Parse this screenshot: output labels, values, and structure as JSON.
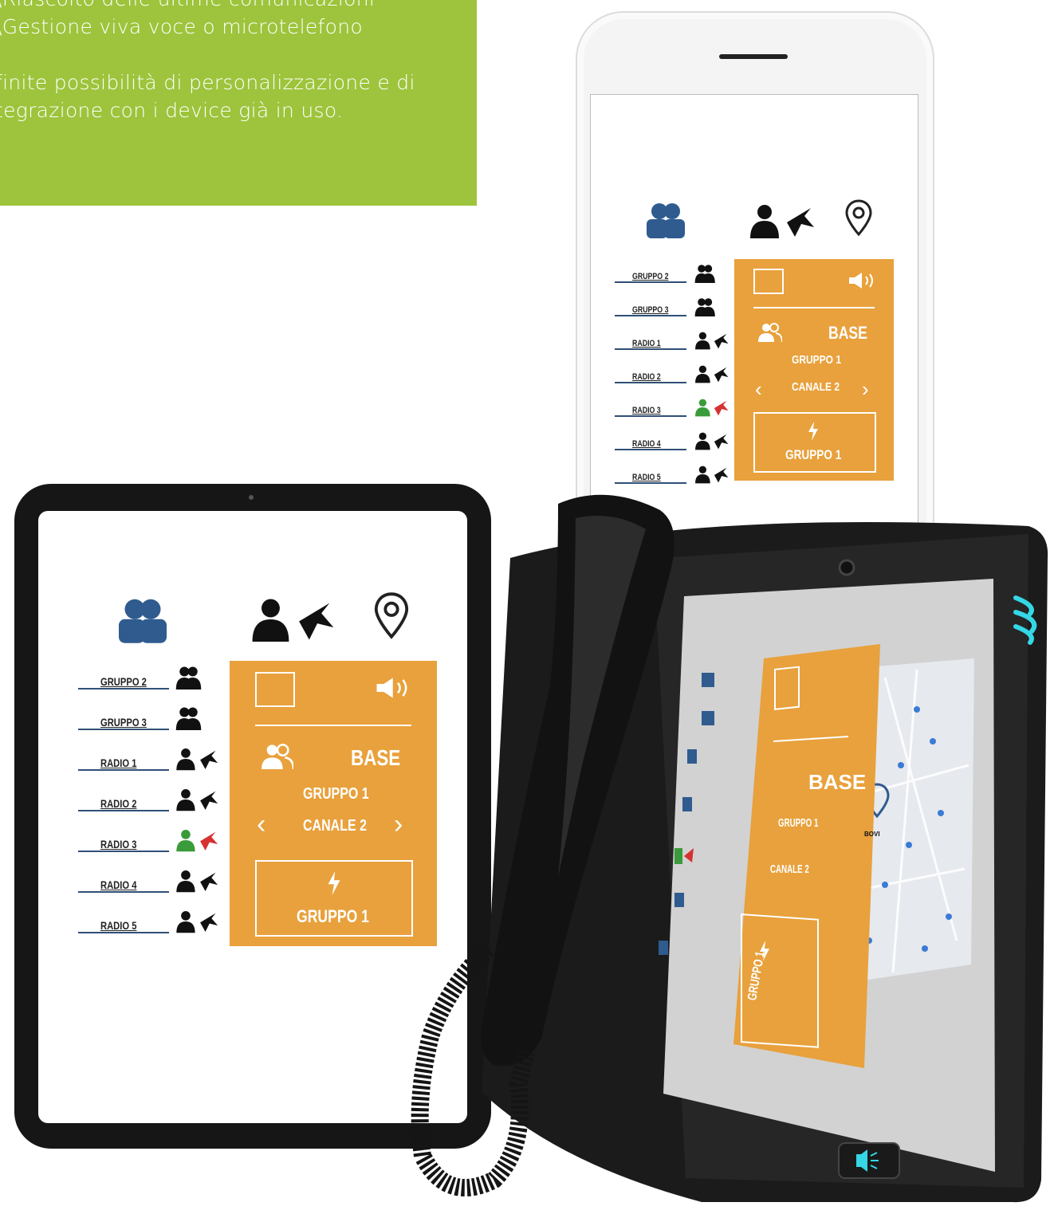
{
  "info_box": {
    "lines": [
      "\\Riascolto delle ultime comunicazioni",
      "\\Gestione viva voce o microtelefono",
      "finite possibilità di personalizzazione e di",
      "tegrazione con i device già in uso."
    ],
    "background": "#9dc43c"
  },
  "app": {
    "accent": "#e8a13c",
    "header_icons": [
      "group-icon",
      "radio-user-icon",
      "location-pin-icon"
    ],
    "rows": [
      {
        "label": "GRUPPO 2",
        "icon": "group-icon"
      },
      {
        "label": "GRUPPO 3",
        "icon": "group-icon"
      },
      {
        "label": "RADIO 1",
        "icon": "radio-user-icon"
      },
      {
        "label": "RADIO 2",
        "icon": "radio-user-icon"
      },
      {
        "label": "RADIO 3",
        "icon": "radio-user-icon",
        "status": "active"
      },
      {
        "label": "RADIO 4",
        "icon": "radio-user-icon"
      },
      {
        "label": "RADIO 5",
        "icon": "radio-user-icon"
      }
    ],
    "panel": {
      "base_label": "BASE",
      "group_label": "GRUPPO 1",
      "channel_label": "CANALE 2",
      "ptt_label": "GRUPPO 1"
    },
    "map_label": "BOVI"
  }
}
